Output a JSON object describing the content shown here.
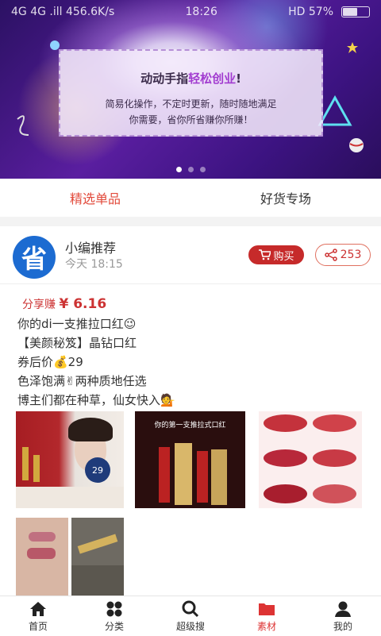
{
  "status": {
    "left": "4G 4G .ill 456.6K/s",
    "time": "18:26",
    "right": "HD 57%"
  },
  "banner": {
    "title_a": "动动手指",
    "title_hl": "轻松创业",
    "title_b": "!",
    "sub1": "简易化操作，不定时更新，随时随地满足",
    "sub2": "你需要，省你所省赚你所赚！"
  },
  "tabs": [
    {
      "label": "精选单品"
    },
    {
      "label": "好货专场"
    }
  ],
  "post": {
    "avatar_text": "省",
    "author": "小编推荐",
    "time": "今天 18:15",
    "buy_label": "购买",
    "share_count": "253",
    "earn_label": "分享赚",
    "earn_value": "¥ 6.16",
    "lines": [
      "你的di一支推拉口红😉",
      "【美颜秘笈】晶钻口红",
      "券后价💰29",
      "色泽饱满✌两种质地任选",
      "博主们都在种草，仙女快入💁"
    ],
    "images": [
      {
        "label": "model-lipstick-photo",
        "price": "29"
      },
      {
        "label": "product-box-photo",
        "text": "你的第一支推拉式口红"
      },
      {
        "label": "lip-swatch-grid"
      },
      {
        "label": "arm-swatch-photo"
      },
      {
        "label": "gold-tube-photo"
      }
    ]
  },
  "nav": [
    {
      "label": "首页",
      "icon": "home-icon"
    },
    {
      "label": "分类",
      "icon": "category-icon"
    },
    {
      "label": "超级搜",
      "icon": "search-icon"
    },
    {
      "label": "素材",
      "icon": "folder-icon",
      "active": true
    },
    {
      "label": "我的",
      "icon": "user-icon"
    }
  ],
  "colors": {
    "accent": "#e24a3b",
    "buy": "#c62a2a",
    "avatar": "#1c6bd1"
  }
}
